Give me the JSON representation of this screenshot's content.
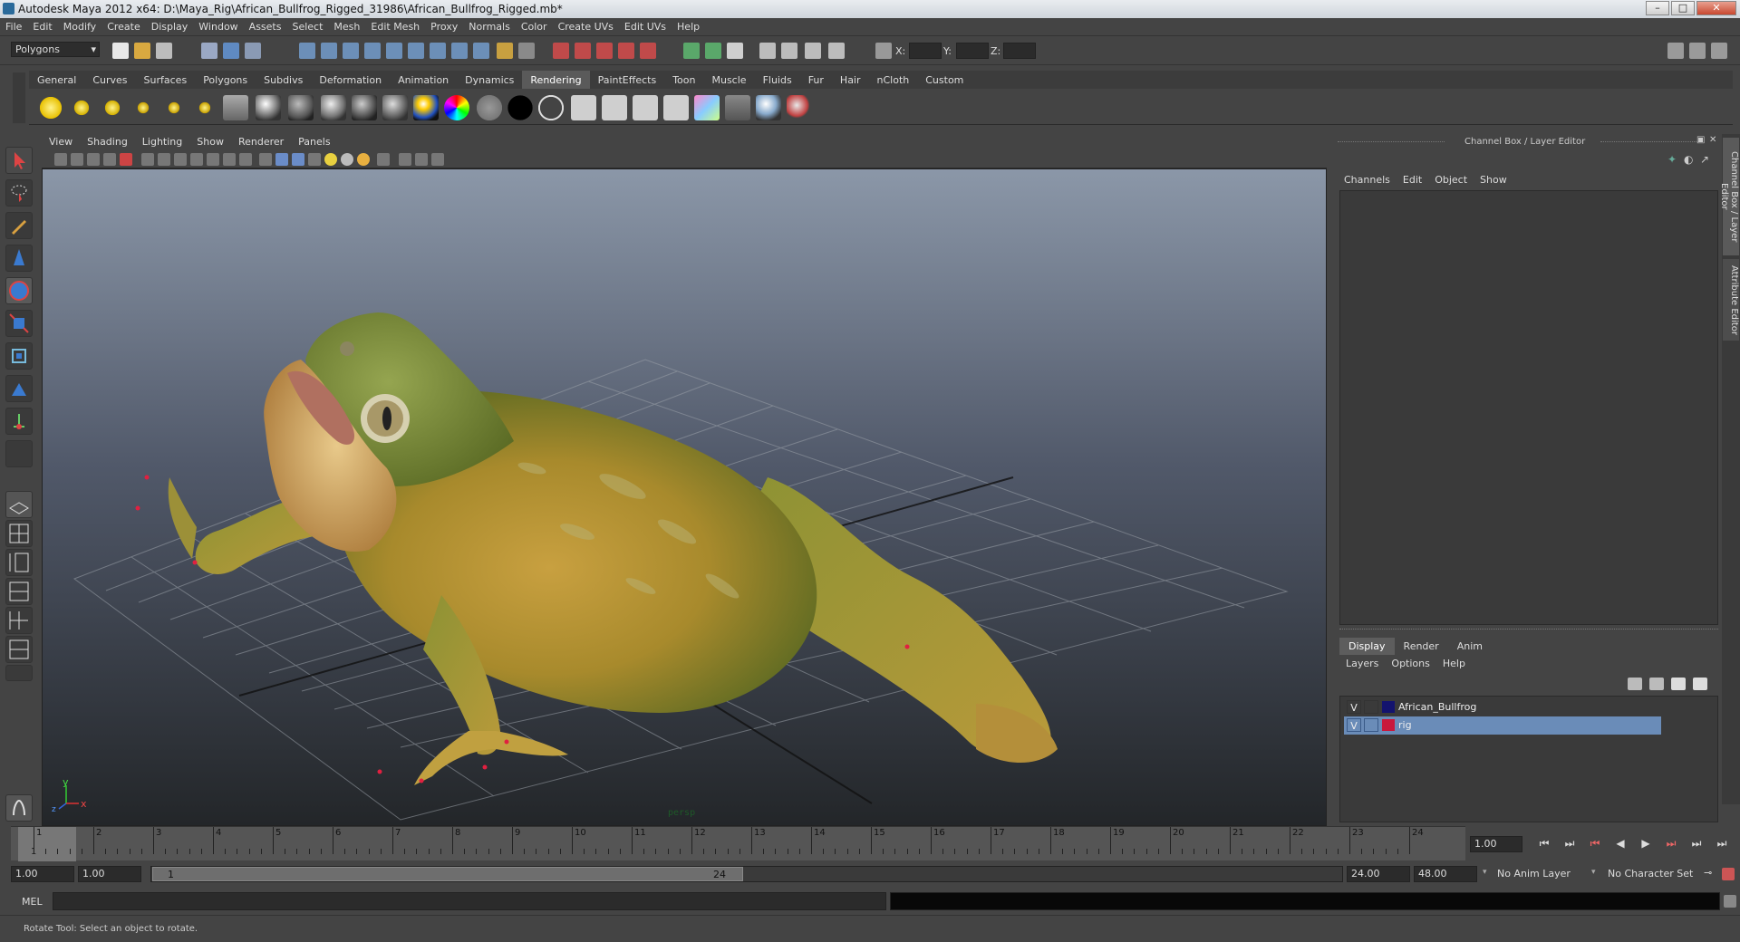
{
  "window": {
    "title": "Autodesk Maya 2012 x64: D:\\Maya_Rig\\African_Bullfrog_Rigged_31986\\African_Bullfrog_Rigged.mb*",
    "minimize": "–",
    "maximize": "□",
    "close": "✕"
  },
  "menubar": [
    "File",
    "Edit",
    "Modify",
    "Create",
    "Display",
    "Window",
    "Assets",
    "Select",
    "Mesh",
    "Edit Mesh",
    "Proxy",
    "Normals",
    "Color",
    "Create UVs",
    "Edit UVs",
    "Help"
  ],
  "statusline": {
    "mode": "Polygons",
    "x_label": "X:",
    "y_label": "Y:",
    "z_label": "Z:"
  },
  "shelf_tabs": [
    "General",
    "Curves",
    "Surfaces",
    "Polygons",
    "Subdivs",
    "Deformation",
    "Animation",
    "Dynamics",
    "Rendering",
    "PaintEffects",
    "Toon",
    "Muscle",
    "Fluids",
    "Fur",
    "Hair",
    "nCloth",
    "Custom"
  ],
  "shelf_active_tab": "Rendering",
  "viewport": {
    "menu": [
      "View",
      "Shading",
      "Lighting",
      "Show",
      "Renderer",
      "Panels"
    ],
    "camera_label": "persp",
    "axis_y": "y",
    "axis_x": "x",
    "axis_z": "z"
  },
  "channel_box": {
    "title": "Channel Box / Layer Editor",
    "menu": [
      "Channels",
      "Edit",
      "Object",
      "Show"
    ]
  },
  "layer_editor": {
    "tabs": [
      "Display",
      "Render",
      "Anim"
    ],
    "active_tab": "Display",
    "menu": [
      "Layers",
      "Options",
      "Help"
    ],
    "layers": [
      {
        "visible": "V",
        "name": "African_Bullfrog",
        "color": "#13136e",
        "selected": false
      },
      {
        "visible": "V",
        "name": "rig",
        "color": "#c8183c",
        "selected": true
      }
    ]
  },
  "side_tabs": [
    "Channel Box / Layer Editor",
    "Attribute Editor"
  ],
  "time_slider": {
    "ticks": [
      "1",
      "2",
      "3",
      "4",
      "5",
      "6",
      "7",
      "8",
      "9",
      "10",
      "11",
      "12",
      "13",
      "14",
      "15",
      "16",
      "17",
      "18",
      "19",
      "20",
      "21",
      "22",
      "23",
      "24"
    ],
    "current_frame": "1",
    "current_time_field": "1.00"
  },
  "playback_buttons": [
    "⏮",
    "⏭",
    "⏮",
    "◀",
    "▶",
    "⏭",
    "⏭",
    "⏭"
  ],
  "range": {
    "start": "1.00",
    "inner_start": "1.00",
    "slider_start": "1",
    "slider_end": "24",
    "inner_end": "24.00",
    "end": "48.00",
    "anim_layer": "No Anim Layer",
    "character_set": "No Character Set"
  },
  "command_line": {
    "label": "MEL"
  },
  "help_line": "Rotate Tool: Select an object to rotate.",
  "colors": {
    "ui_bg": "#444444",
    "selected_layer": "#6a8cb8",
    "viewport_top": "#8b97a8",
    "viewport_bottom": "#232629"
  }
}
